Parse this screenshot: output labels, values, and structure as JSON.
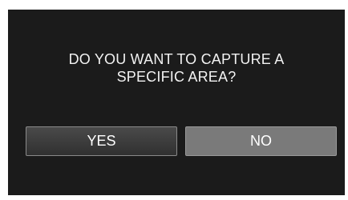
{
  "dialog": {
    "message_line1": "DO YOU WANT TO CAPTURE A",
    "message_line2": "SPECIFIC AREA?",
    "yes_label": "YES",
    "no_label": "NO"
  },
  "colors": {
    "screen_background": "#1b1b1b",
    "yes_button": "#3a3a3a",
    "no_button_selected": "#7a7a7a",
    "text": "#ffffff"
  }
}
